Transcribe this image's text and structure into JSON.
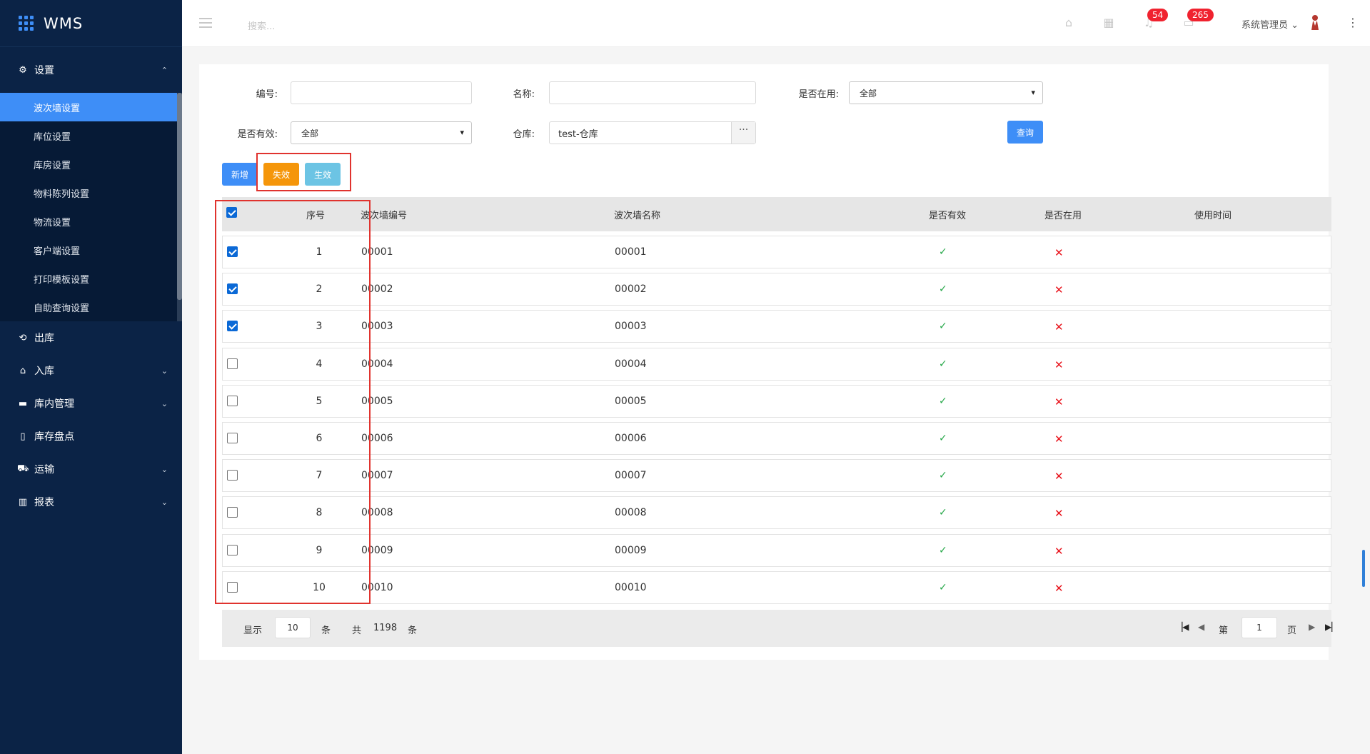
{
  "brand": {
    "name": "WMS"
  },
  "sidebar": {
    "settings": {
      "label": "设置",
      "icon": "gear-icon"
    },
    "sub_items": [
      {
        "label": "波次墙设置",
        "active": true
      },
      {
        "label": "库位设置"
      },
      {
        "label": "库房设置"
      },
      {
        "label": "物料陈列设置"
      },
      {
        "label": "物流设置"
      },
      {
        "label": "客户端设置"
      },
      {
        "label": "打印模板设置"
      },
      {
        "label": "自助查询设置"
      }
    ],
    "groups": [
      {
        "label": "出库",
        "icon": "outbound-icon",
        "expandable": false
      },
      {
        "label": "入库",
        "icon": "inbound-icon",
        "expandable": true
      },
      {
        "label": "库内管理",
        "icon": "warehouse-icon",
        "expandable": true
      },
      {
        "label": "库存盘点",
        "icon": "inventory-icon",
        "expandable": false
      },
      {
        "label": "运输",
        "icon": "truck-icon",
        "expandable": true
      },
      {
        "label": "报表",
        "icon": "report-icon",
        "expandable": true
      }
    ]
  },
  "header": {
    "search_placeholder": "搜索...",
    "notifications_count": "54",
    "messages_count": "265",
    "user_name": "系统管理员"
  },
  "filters": {
    "code_label": "编号:",
    "name_label": "名称:",
    "in_use_label": "是否在用:",
    "in_use_value": "全部",
    "valid_label": "是否有效:",
    "valid_value": "全部",
    "warehouse_label": "仓库:",
    "warehouse_value": "test-仓库",
    "query_button": "查询"
  },
  "actions": {
    "add": "新增",
    "invalidate": "失效",
    "validate": "生效"
  },
  "colors": {
    "sidebar_bg": "#0b2346",
    "accent": "#3e8ef7",
    "invalidate_btn": "#f5960a",
    "validate_btn": "#6cc4e4",
    "highlight_box": "#e0332e"
  },
  "table": {
    "headers": [
      "序号",
      "波次墙编号",
      "波次墙名称",
      "是否有效",
      "是否在用",
      "使用时间"
    ],
    "header_checked": true,
    "rows": [
      {
        "checked": true,
        "index": "1",
        "code": "00001",
        "name": "00001",
        "valid": "✓",
        "in_use": "✕",
        "time": ""
      },
      {
        "checked": true,
        "index": "2",
        "code": "00002",
        "name": "00002",
        "valid": "✓",
        "in_use": "✕",
        "time": ""
      },
      {
        "checked": true,
        "index": "3",
        "code": "00003",
        "name": "00003",
        "valid": "✓",
        "in_use": "✕",
        "time": ""
      },
      {
        "checked": false,
        "index": "4",
        "code": "00004",
        "name": "00004",
        "valid": "✓",
        "in_use": "✕",
        "time": ""
      },
      {
        "checked": false,
        "index": "5",
        "code": "00005",
        "name": "00005",
        "valid": "✓",
        "in_use": "✕",
        "time": ""
      },
      {
        "checked": false,
        "index": "6",
        "code": "00006",
        "name": "00006",
        "valid": "✓",
        "in_use": "✕",
        "time": ""
      },
      {
        "checked": false,
        "index": "7",
        "code": "00007",
        "name": "00007",
        "valid": "✓",
        "in_use": "✕",
        "time": ""
      },
      {
        "checked": false,
        "index": "8",
        "code": "00008",
        "name": "00008",
        "valid": "✓",
        "in_use": "✕",
        "time": ""
      },
      {
        "checked": false,
        "index": "9",
        "code": "00009",
        "name": "00009",
        "valid": "✓",
        "in_use": "✕",
        "time": ""
      },
      {
        "checked": false,
        "index": "10",
        "code": "00010",
        "name": "00010",
        "valid": "✓",
        "in_use": "✕",
        "time": ""
      }
    ]
  },
  "pager": {
    "show_label": "显示",
    "page_size": "10",
    "unit_label": "条",
    "total_label": "共",
    "total": "1198",
    "total_unit": "条",
    "page_prefix": "第",
    "current_page": "1",
    "page_suffix": "页"
  }
}
